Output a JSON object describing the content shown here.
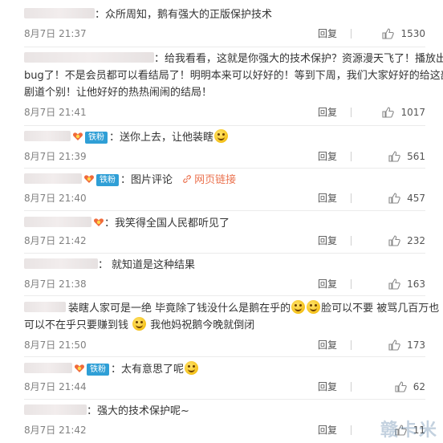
{
  "comments": [
    {
      "text": "众所周知，鹅有强大的正版保护技术",
      "time": "8月7日 21:37",
      "reply": "回复",
      "likes": "1530"
    },
    {
      "text_line1": "给我看看，这就是你强大的技术保护？资源漫天飞了！播放出",
      "text_line2": "bug了！不是会员都可以看结局了！明明本来可以好好的！等到下周，我们大家好好的给这部",
      "text_line3": "剧道个别！让他好好的热热闹闹的结局！",
      "time": "8月7日 21:41",
      "reply": "回复",
      "likes": "1017"
    },
    {
      "badge": "铁粉",
      "text": "送你上去，让他装瞎",
      "time": "8月7日 21:39",
      "reply": "回复",
      "likes": "561"
    },
    {
      "badge": "铁粉",
      "text": "图片评论",
      "link": "网页链接",
      "time": "8月7日 21:40",
      "reply": "回复",
      "likes": "457"
    },
    {
      "text": "我笑得全国人民都听见了",
      "time": "8月7日 21:42",
      "reply": "回复",
      "likes": "232"
    },
    {
      "text": "就知道是这种结果",
      "time": "8月7日 21:38",
      "reply": "回复",
      "likes": "163"
    },
    {
      "text_line1a": "装瞎人家可是一绝  毕竟除了钱没什么是鹅在乎的",
      "text_line1b": "脸可以不要  被骂几百万也",
      "text_line2a": "可以不在乎只要赚到钱",
      "text_line2b": "我他妈祝鹅今晚就倒闭",
      "time": "8月7日 21:50",
      "reply": "回复",
      "likes": "173"
    },
    {
      "badge": "铁粉",
      "text": "太有意思了呢",
      "time": "8月7日 21:44",
      "reply": "回复",
      "likes": "62"
    },
    {
      "text": "强大的技术保护呢~",
      "time": "8月7日 21:42",
      "reply": "回复",
      "likes": "11"
    }
  ],
  "colon": "：",
  "watermark": "赣卡米",
  "icons": {
    "like": "thumbs-up-icon",
    "fan": "fan-heart-icon",
    "emoji": "smile-emoji-icon",
    "link": "link-icon"
  },
  "colors": {
    "badge": "#2f9fd6",
    "link": "#eb7350",
    "meta": "#808080"
  }
}
